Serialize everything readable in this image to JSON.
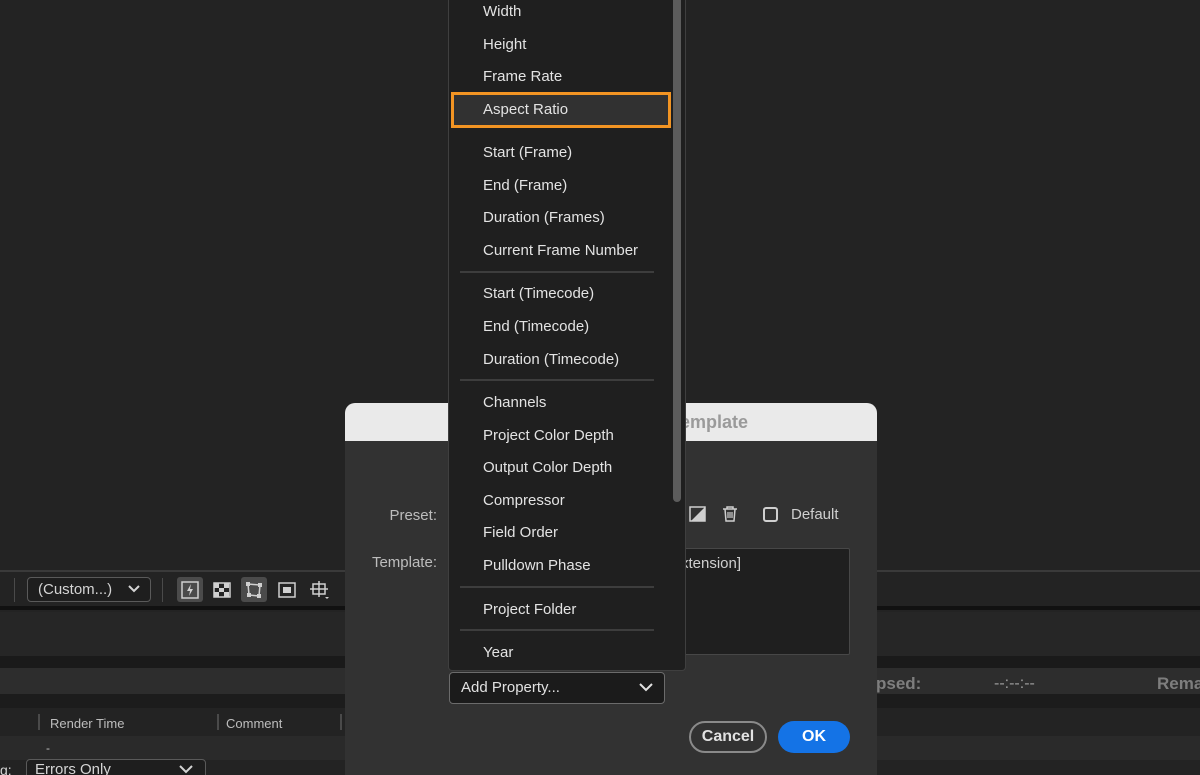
{
  "toolbar": {
    "resolution_select": "(Custom...)"
  },
  "render_queue": {
    "columns": {
      "render_time": "Render Time",
      "comment": "Comment"
    },
    "row_value": "-",
    "log_label": "g:",
    "log_select": "Errors Only",
    "elapsed_label": "psed:",
    "elapsed_value": "--:--:--",
    "remaining_label": "Rema"
  },
  "dialog": {
    "title": "emplate",
    "preset_label": "Preset:",
    "template_label": "Template:",
    "template_text": "xtension]",
    "default_label": "Default",
    "add_property": "Add Property...",
    "cancel": "Cancel",
    "ok": "OK"
  },
  "menu": {
    "highlight_color": "#f29423",
    "items": [
      "Width",
      "Height",
      "Frame Rate",
      "Aspect Ratio",
      "Start (Frame)",
      "End (Frame)",
      "Duration (Frames)",
      "Current Frame Number",
      "Start (Timecode)",
      "End (Timecode)",
      "Duration (Timecode)",
      "Channels",
      "Project Color Depth",
      "Output Color Depth",
      "Compressor",
      "Field Order",
      "Pulldown Phase",
      "Project Folder",
      "Year"
    ]
  }
}
